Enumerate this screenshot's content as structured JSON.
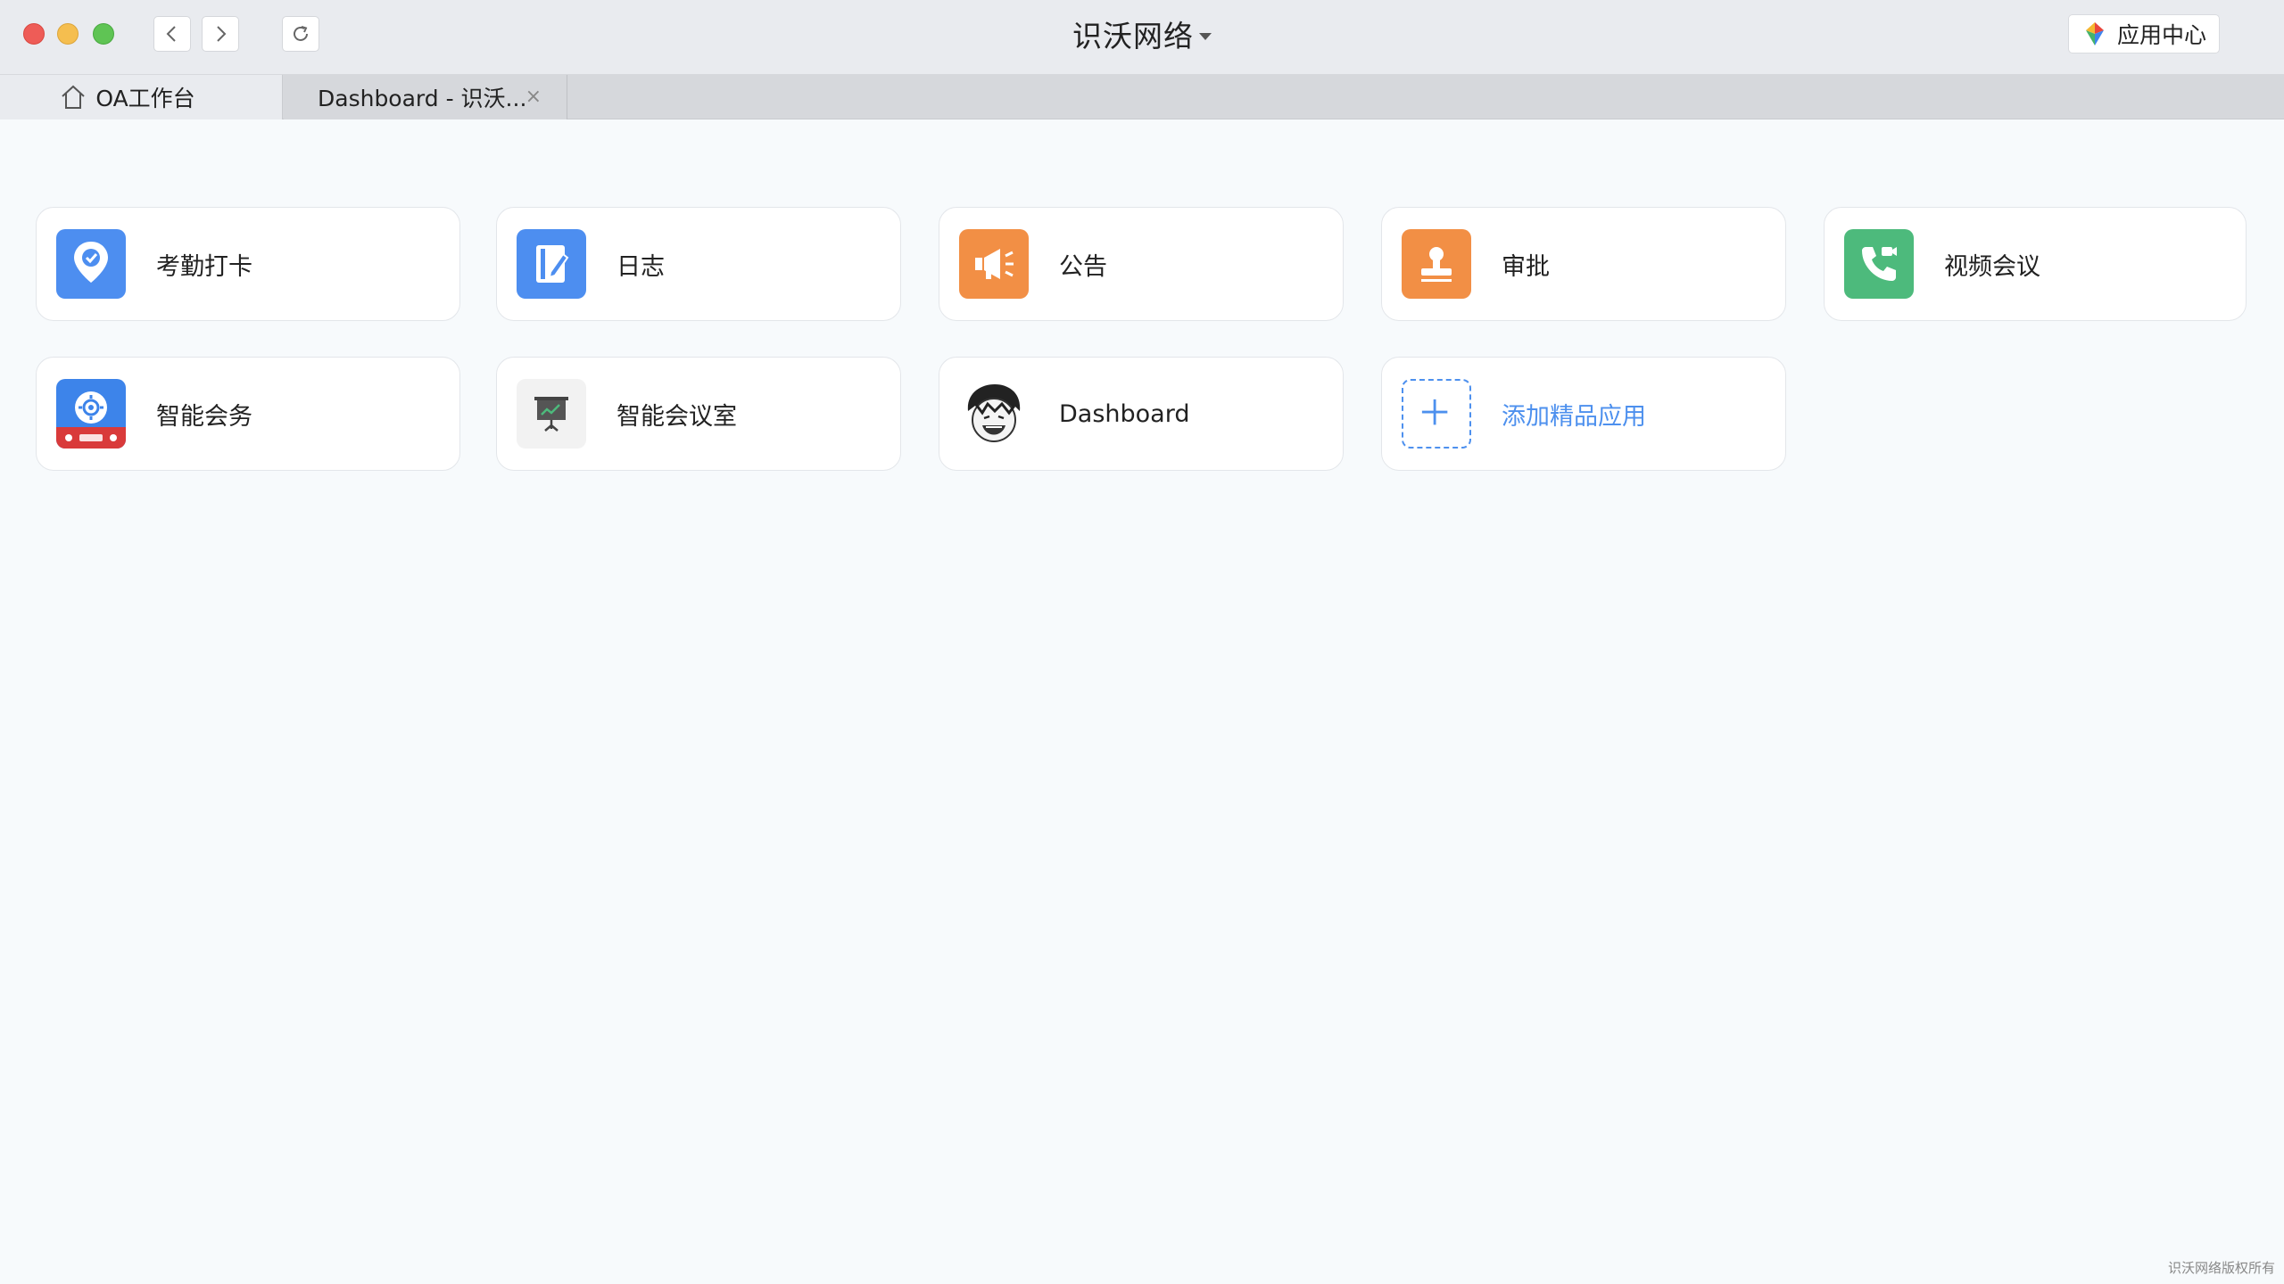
{
  "window": {
    "title": "识沃网络",
    "app_center_label": "应用中心"
  },
  "tabs": [
    {
      "label": "OA工作台"
    },
    {
      "label": "Dashboard - 识沃...",
      "close": "×"
    }
  ],
  "apps": [
    {
      "label": "考勤打卡",
      "icon": "location-check-icon",
      "color": "#4d8ef0"
    },
    {
      "label": "日志",
      "icon": "journal-edit-icon",
      "color": "#4d8ef0"
    },
    {
      "label": "公告",
      "icon": "megaphone-icon",
      "color": "#f28f45"
    },
    {
      "label": "审批",
      "icon": "stamp-icon",
      "color": "#f28f45"
    },
    {
      "label": "视频会议",
      "icon": "video-phone-icon",
      "color": "#4dba7c"
    },
    {
      "label": "智能会务",
      "icon": "smart-conference-icon",
      "color": "#3d84ea"
    },
    {
      "label": "智能会议室",
      "icon": "meeting-room-board-icon",
      "color": "#f2f2f2"
    },
    {
      "label": "Dashboard",
      "icon": "cartoon-avatar-icon",
      "color": "#ffffff"
    },
    {
      "label": "添加精品应用",
      "icon": "add-plus-icon",
      "color": "#4d90ee"
    }
  ],
  "footer": "识沃网络版权所有"
}
